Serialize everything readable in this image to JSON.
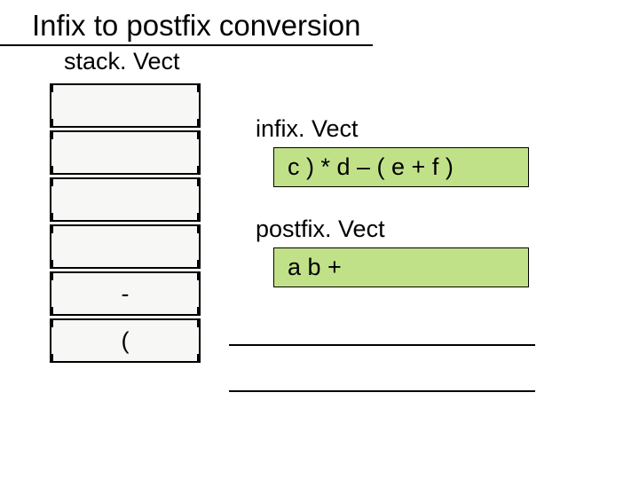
{
  "title": "Infix to postfix conversion",
  "labels": {
    "stack": "stack. Vect",
    "infix": "infix. Vect",
    "postfix": "postfix. Vect"
  },
  "stack": {
    "slots": [
      "",
      "",
      "",
      "",
      "-",
      "("
    ]
  },
  "infix": {
    "value": "c ) * d – ( e + f )"
  },
  "postfix": {
    "value": "a b +"
  }
}
